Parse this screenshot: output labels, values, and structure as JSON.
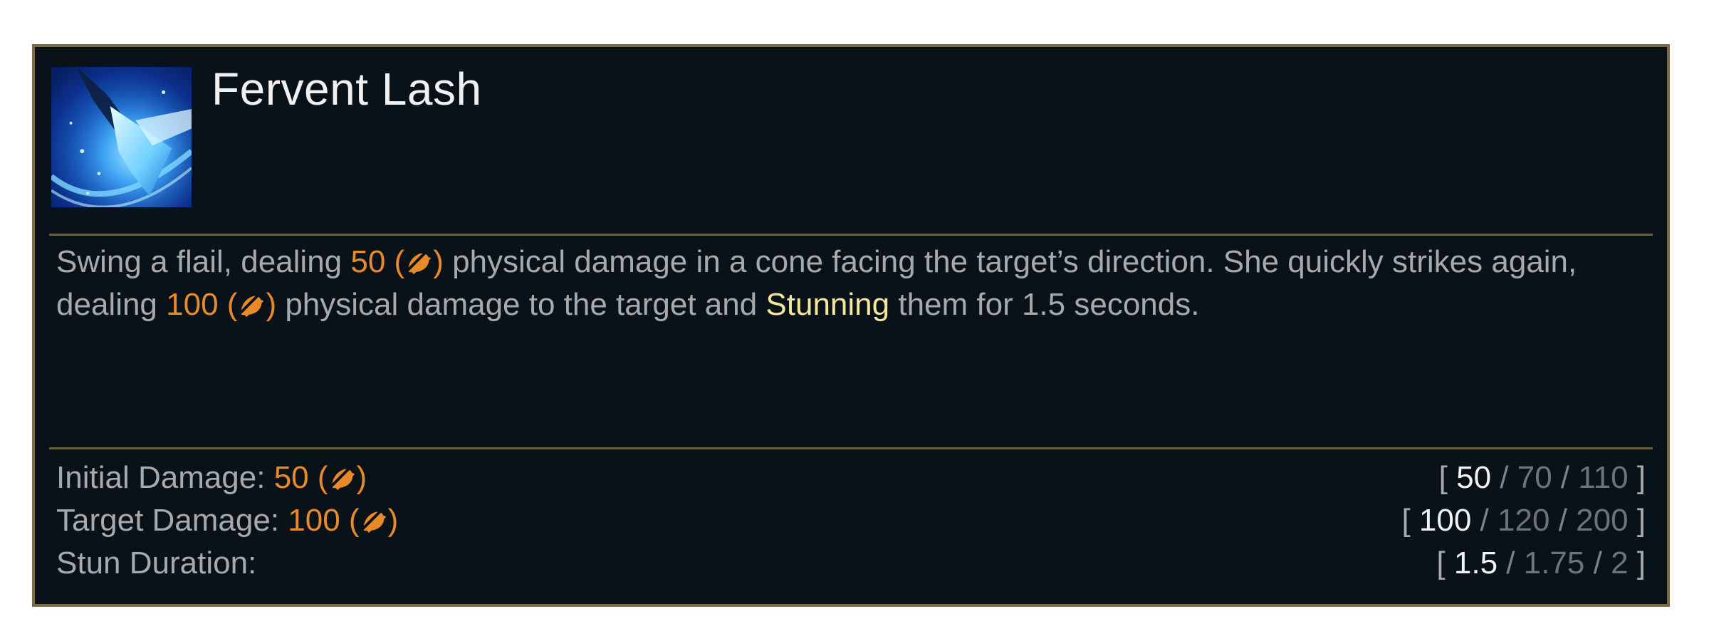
{
  "ability": {
    "name": "Fervent Lash",
    "icon": "flail-strike-ability-icon"
  },
  "description": {
    "part1": "Swing a flail, dealing ",
    "dmg1": "50 (",
    "dmg1_close": ")",
    "part2": " physical damage in a cone facing the target’s direction. She quickly strikes again, dealing ",
    "dmg2": "100 (",
    "dmg2_close": ")",
    "part3": " physical damage to the target and ",
    "status": "Stunning",
    "part4": " them for 1.5 seconds."
  },
  "stats": [
    {
      "label": "Initial Damage: ",
      "value": "50 (",
      "value_close": ")",
      "open": "[ ",
      "current": "50",
      "sep": " / ",
      "rank2": "70",
      "rank3": "110",
      "close": " ]"
    },
    {
      "label": "Target Damage: ",
      "value": "100 (",
      "value_close": ")",
      "open": "[ ",
      "current": "100",
      "sep": " / ",
      "rank2": "120",
      "rank3": "200",
      "close": " ]"
    },
    {
      "label": "Stun Duration:",
      "open": "[ ",
      "current": "1.5",
      "sep": " / ",
      "rank2": "1.75",
      "rank3": "2",
      "close": " ]"
    }
  ],
  "colors": {
    "background": "#0a1219",
    "border": "#7a6a45",
    "text": "#a7a9ab",
    "damage": "#e98a2a",
    "status": "#f3e79a",
    "title": "#f0f0f0"
  },
  "icons": {
    "damage_type": "attack-damage-icon"
  }
}
